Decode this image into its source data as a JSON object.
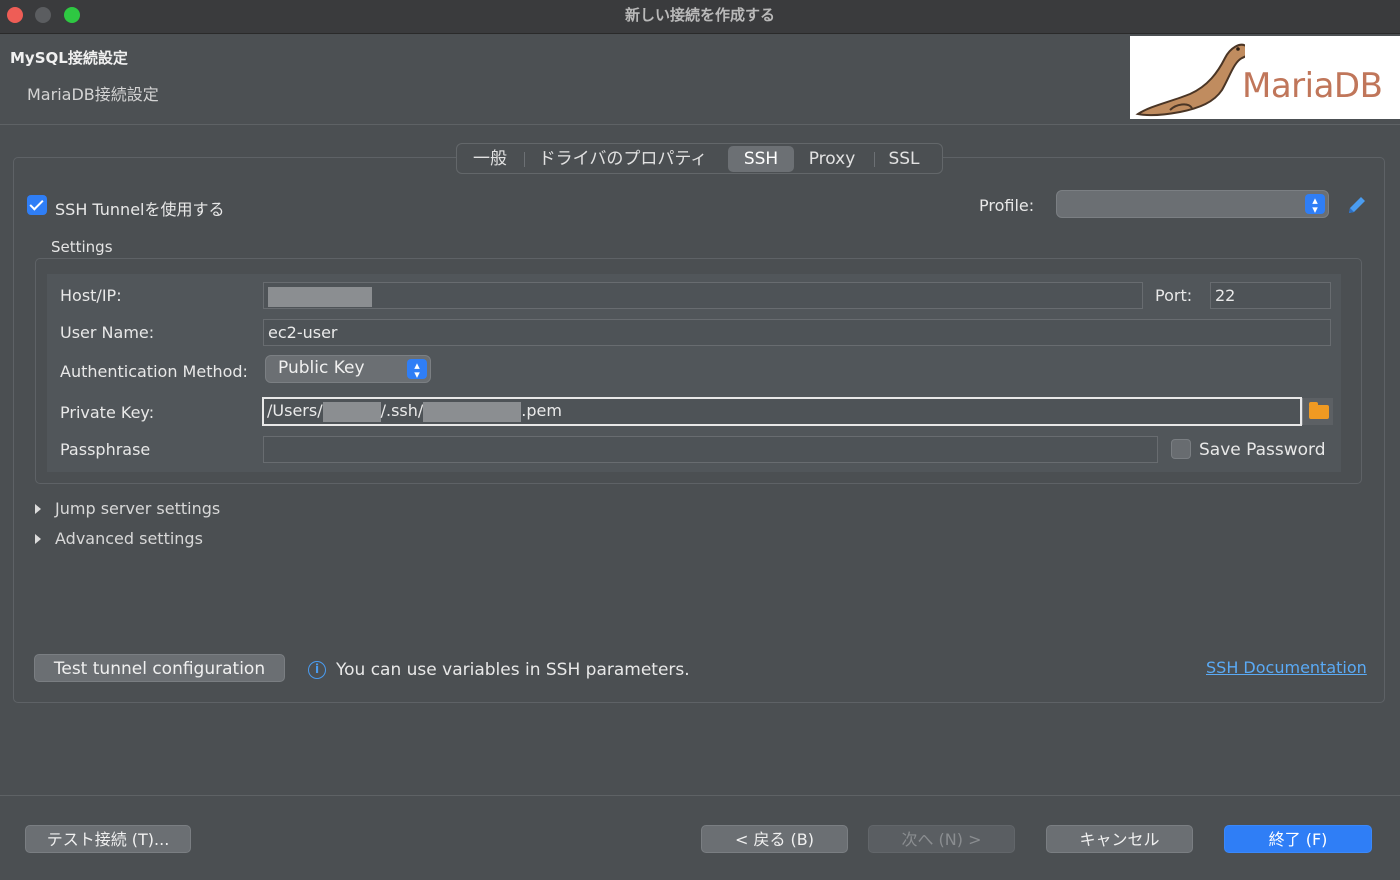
{
  "window": {
    "title": "新しい接続を作成する"
  },
  "header": {
    "title": "MySQL接続設定",
    "subtitle": "MariaDB接続設定",
    "logo_text": "MariaDB"
  },
  "tabs": [
    {
      "label": "一般",
      "active": false
    },
    {
      "label": "ドライバのプロパティ",
      "active": false
    },
    {
      "label": "SSH",
      "active": true
    },
    {
      "label": "Proxy",
      "active": false
    },
    {
      "label": "SSL",
      "active": false
    }
  ],
  "ssh": {
    "use_tunnel_label": "SSH Tunnelを使用する",
    "use_tunnel_checked": true,
    "profile_label": "Profile:",
    "profile_value": "",
    "settings_label": "Settings",
    "host_label": "Host/IP:",
    "port_label": "Port:",
    "port_value": "22",
    "username_label": "User Name:",
    "username_value": "ec2-user",
    "auth_label": "Authentication Method:",
    "auth_value": "Public Key",
    "private_key_label": "Private Key:",
    "private_key_prefix": "/Users/",
    "private_key_mid": "/.ssh/",
    "private_key_suffix": ".pem",
    "passphrase_label": "Passphrase",
    "passphrase_value": "",
    "save_password_label": "Save Password",
    "save_password_checked": false,
    "jump_server_label": "Jump server settings",
    "advanced_label": "Advanced settings",
    "test_tunnel_label": "Test tunnel configuration",
    "info_text": "You can use variables in SSH parameters.",
    "doc_link": "SSH Documentation"
  },
  "footer": {
    "test_connection": "テスト接続 (T)...",
    "back": "< 戻る (B)",
    "next": "次へ (N) >",
    "cancel": "キャンセル",
    "finish": "終了 (F)"
  },
  "colors": {
    "accent": "#2f7ef6",
    "link": "#5aaaf5",
    "folder": "#f09a22"
  }
}
